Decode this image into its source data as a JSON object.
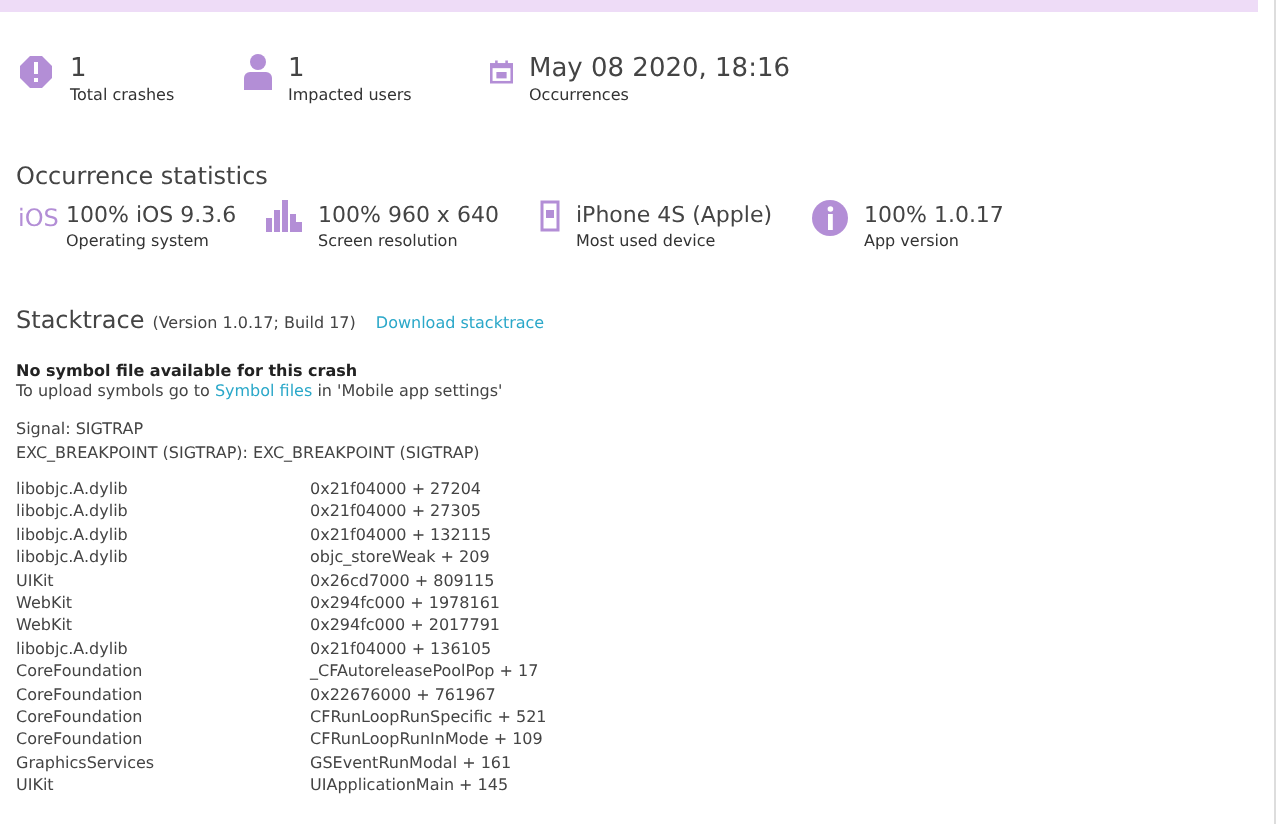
{
  "summary": [
    {
      "kind": "crash",
      "value": "1",
      "label": "Total crashes"
    },
    {
      "kind": "users",
      "value": "1",
      "label": "Impacted users"
    },
    {
      "kind": "calendar",
      "value": "May 08 2020, 18:16",
      "label": "Occurrences"
    }
  ],
  "occurrence_statistics": {
    "title": "Occurrence statistics",
    "items": [
      {
        "kind": "os",
        "icon_text": "iOS",
        "value": "100% iOS 9.3.6",
        "label": "Operating system"
      },
      {
        "kind": "resolution",
        "value": "100% 960 x 640",
        "label": "Screen resolution"
      },
      {
        "kind": "device",
        "value": "iPhone 4S (Apple)",
        "label": "Most used device"
      },
      {
        "kind": "info",
        "value": "100% 1.0.17",
        "label": "App version"
      }
    ]
  },
  "stacktrace": {
    "title": "Stacktrace",
    "version": "(Version 1.0.17; Build 17)",
    "download_link": "Download stacktrace",
    "notice_title": "No symbol file available for this crash",
    "notice_before": "To upload symbols go to",
    "notice_link": "Symbol files",
    "notice_after": "in 'Mobile app settings'",
    "signal": "Signal: SIGTRAP",
    "exception": "EXC_BREAKPOINT (SIGTRAP): EXC_BREAKPOINT (SIGTRAP)",
    "frames": [
      {
        "module": "libobjc.A.dylib",
        "address": "0x21f04000 + 27204"
      },
      {
        "module": "libobjc.A.dylib",
        "address": "0x21f04000 + 27305"
      },
      {
        "module": "libobjc.A.dylib",
        "address": "0x21f04000 + 132115"
      },
      {
        "module": "libobjc.A.dylib",
        "address": "objc_storeWeak + 209"
      },
      {
        "module": "UIKit",
        "address": "0x26cd7000 + 809115"
      },
      {
        "module": "WebKit",
        "address": "0x294fc000 + 1978161"
      },
      {
        "module": "WebKit",
        "address": "0x294fc000 + 2017791"
      },
      {
        "module": "libobjc.A.dylib",
        "address": "0x21f04000 + 136105"
      },
      {
        "module": "CoreFoundation",
        "address": "_CFAutoreleasePoolPop + 17"
      },
      {
        "module": "CoreFoundation",
        "address": "0x22676000 + 761967"
      },
      {
        "module": "CoreFoundation",
        "address": "CFRunLoopRunSpecific + 521"
      },
      {
        "module": "CoreFoundation",
        "address": "CFRunLoopRunInMode + 109"
      },
      {
        "module": "GraphicsServices",
        "address": "GSEventRunModal + 161"
      },
      {
        "module": "UIKit",
        "address": "UIApplicationMain + 145"
      }
    ]
  }
}
